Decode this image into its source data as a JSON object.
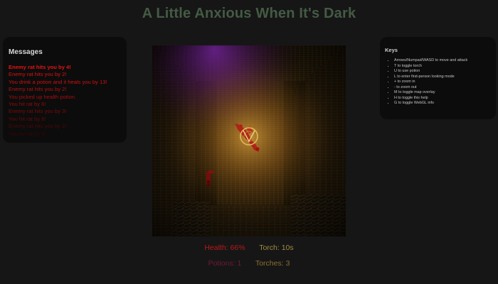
{
  "title": "A Little Anxious When It's Dark",
  "messages": {
    "heading": "Messages",
    "items": [
      {
        "text": "Enemy rat hits you by 4!",
        "color": "#e31414",
        "bold": true
      },
      {
        "text": "Enemy rat hits you by 2!",
        "color": "#d81313",
        "bold": false
      },
      {
        "text": "You drink a potion and it heals you by 13!",
        "color": "#cc1212",
        "bold": false
      },
      {
        "text": "Enemy rat hits you by 2!",
        "color": "#b51010",
        "bold": false
      },
      {
        "text": "You picked up health potion.",
        "color": "#a30f0f",
        "bold": false
      },
      {
        "text": "You hit rat by 6!",
        "color": "#900d0d",
        "bold": false
      },
      {
        "text": "Enemy rat hits you by 3!",
        "color": "#7a0b0b",
        "bold": false
      },
      {
        "text": "You hit rat by 8!",
        "color": "#620909",
        "bold": false
      },
      {
        "text": "Enemy rat hits you by 2!",
        "color": "#4c0707",
        "bold": false
      },
      {
        "text": "You hit rat by 5!",
        "color": "#380505",
        "bold": false
      }
    ]
  },
  "keys": {
    "heading": "Keys",
    "items": [
      "Arrows/Numpad/WASD to move and attack",
      "T to toggle torch",
      "U to use potion",
      "L to enter first-person looking mode",
      "+ to zoom in",
      "- to zoom out",
      "M to toggle map overlay",
      "H to toggle this help",
      "G to toggle WebGL info"
    ]
  },
  "stats": {
    "health_label": "Health:",
    "health_value": "66%",
    "torch_label": "Torch:",
    "torch_value": "10s",
    "potions_label": "Potions:",
    "potions_value": "1",
    "torches_label": "Torches:",
    "torches_value": "3"
  },
  "colors": {
    "title": "#445a44",
    "health": "#b81a1a",
    "torch": "#a08a40",
    "potions": "#6e1a3a",
    "torches": "#8a7030",
    "purple_light": "#7a1fa8",
    "torch_glow": "#e8a020",
    "enemy_blood": "#a01010"
  },
  "game_view": {
    "player_icon": "player-ring-icon",
    "light_sources": [
      "purple-light",
      "torch-light"
    ]
  }
}
